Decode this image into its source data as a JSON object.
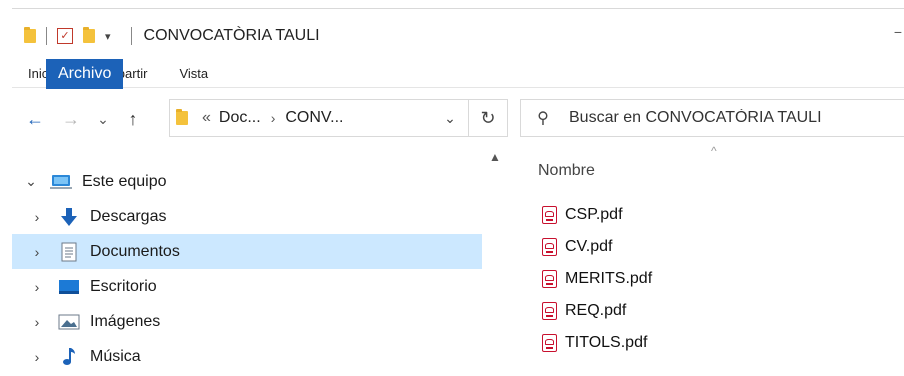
{
  "window": {
    "title": "CONVOCATÒRIA TAULI",
    "title_right_glyph": "−"
  },
  "quick_access": {
    "dropdown_glyph": "▾"
  },
  "ribbon": {
    "tabs": [
      "Archivo",
      "Inicio",
      "Compartir",
      "Vista"
    ]
  },
  "address": {
    "back": "←",
    "forward": "→",
    "recent": "⌄",
    "up": "↑",
    "overflow": "«",
    "crumbs": [
      "Doc...",
      "CONV..."
    ],
    "sep": "›",
    "dropdown": "⌄",
    "refresh": "↻"
  },
  "search": {
    "placeholder": "Buscar en CONVOCATÒRIA TAULI",
    "icon": "search-icon"
  },
  "nav_pane": {
    "items": [
      {
        "label": "Este equipo",
        "icon": "computer-icon",
        "expanded": true
      },
      {
        "label": "Descargas",
        "icon": "download-icon"
      },
      {
        "label": "Documentos",
        "icon": "documents-icon",
        "selected": true
      },
      {
        "label": "Escritorio",
        "icon": "desktop-icon"
      },
      {
        "label": "Imágenes",
        "icon": "pictures-icon"
      },
      {
        "label": "Música",
        "icon": "music-icon"
      }
    ]
  },
  "content": {
    "column_name": "Nombre",
    "files": [
      "CSP.pdf",
      "CV.pdf",
      "MERITS.pdf",
      "REQ.pdf",
      "TITOLS.pdf"
    ]
  },
  "colors": {
    "accent": "#1c62b8",
    "selection": "#cce8ff",
    "pdf_red": "#c8102e",
    "folder": "#f4c23c"
  }
}
